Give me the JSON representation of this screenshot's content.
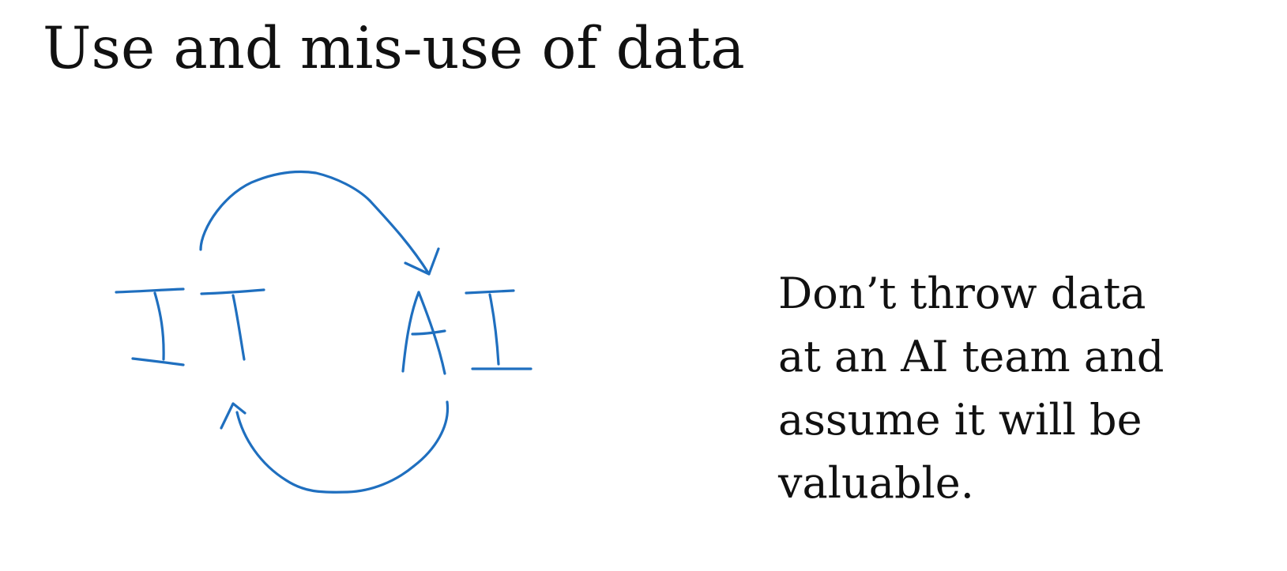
{
  "slide": {
    "title": "Use and mis-use of data"
  },
  "diagram": {
    "left_label": "IT",
    "right_label": "AI",
    "ink_color": "#1f6fbf"
  },
  "note": {
    "lines": [
      "Don’t throw data",
      "at an AI team and",
      "assume it will be",
      "valuable."
    ]
  }
}
